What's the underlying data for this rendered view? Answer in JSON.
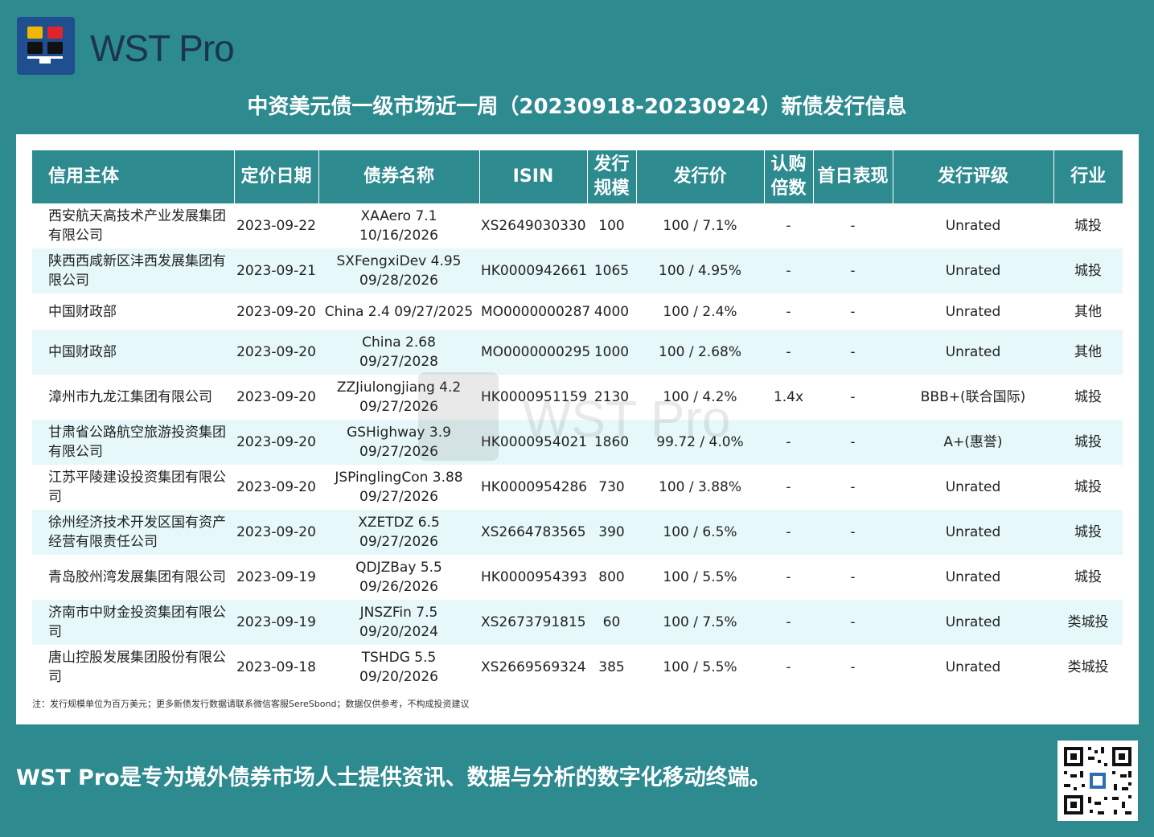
{
  "brand": {
    "name": "WST Pro",
    "logo_colors": [
      "#f2b705",
      "#e1242b",
      "#111111",
      "#111111"
    ]
  },
  "title": "中资美元债一级市场近一周（20230918-20230924）新债发行信息",
  "table": {
    "headers": [
      "信用主体",
      "定价日期",
      "债券名称",
      "ISIN",
      "发行\n规模",
      "发行价",
      "认购\n倍数",
      "首日表现",
      "发行评级",
      "行业"
    ],
    "rows": [
      [
        "西安航天高技术产业发展集团有限公司",
        "2023-09-22",
        "XAAero 7.1\n10/16/2026",
        "XS2649030330",
        "100",
        "100 / 7.1%",
        "-",
        "-",
        "Unrated",
        "城投"
      ],
      [
        "陕西西咸新区沣西发展集团有限公司",
        "2023-09-21",
        "SXFengxiDev 4.95\n09/28/2026",
        "HK0000942661",
        "1065",
        "100 / 4.95%",
        "-",
        "-",
        "Unrated",
        "城投"
      ],
      [
        "中国财政部",
        "2023-09-20",
        "China 2.4 09/27/2025",
        "MO0000000287",
        "4000",
        "100 / 2.4%",
        "-",
        "-",
        "Unrated",
        "其他"
      ],
      [
        "中国财政部",
        "2023-09-20",
        "China 2.68\n09/27/2028",
        "MO0000000295",
        "1000",
        "100 / 2.68%",
        "-",
        "-",
        "Unrated",
        "其他"
      ],
      [
        "漳州市九龙江集团有限公司",
        "2023-09-20",
        "ZZJiulongjiang 4.2\n09/27/2026",
        "HK0000951159",
        "2130",
        "100 / 4.2%",
        "1.4x",
        "-",
        "BBB+(联合国际)",
        "城投"
      ],
      [
        "甘肃省公路航空旅游投资集团有限公司",
        "2023-09-20",
        "GSHighway 3.9\n09/27/2026",
        "HK0000954021",
        "1860",
        "99.72 / 4.0%",
        "-",
        "-",
        "A+(惠誉)",
        "城投"
      ],
      [
        "江苏平陵建设投资集团有限公司",
        "2023-09-20",
        "JSPinglingCon 3.88\n09/27/2026",
        "HK0000954286",
        "730",
        "100 / 3.88%",
        "-",
        "-",
        "Unrated",
        "城投"
      ],
      [
        "徐州经济技术开发区国有资产经营有限责任公司",
        "2023-09-20",
        "XZETDZ 6.5\n09/27/2026",
        "XS2664783565",
        "390",
        "100 / 6.5%",
        "-",
        "-",
        "Unrated",
        "城投"
      ],
      [
        "青岛胶州湾发展集团有限公司",
        "2023-09-19",
        "QDJZBay 5.5\n09/26/2026",
        "HK0000954393",
        "800",
        "100 / 5.5%",
        "-",
        "-",
        "Unrated",
        "城投"
      ],
      [
        "济南市中财金投资集团有限公司",
        "2023-09-19",
        "JNSZFin 7.5\n09/20/2024",
        "XS2673791815",
        "60",
        "100 / 7.5%",
        "-",
        "-",
        "Unrated",
        "类城投"
      ],
      [
        "唐山控股发展集团股份有限公司",
        "2023-09-18",
        "TSHDG 5.5\n09/20/2026",
        "XS2669569324",
        "385",
        "100 / 5.5%",
        "-",
        "-",
        "Unrated",
        "类城投"
      ]
    ]
  },
  "note": "注：发行规模单位为百万美元；更多新债发行数据请联系微信客服SereSbond；数据仅供参考，不构成投资建议",
  "tagline": "WST Pro是专为境外债券市场人士提供资讯、数据与分析的数字化移动终端。",
  "colors": {
    "background": "#2d8a8f",
    "header": "#2d8a8f",
    "alt_row": "#e6f8f9"
  }
}
